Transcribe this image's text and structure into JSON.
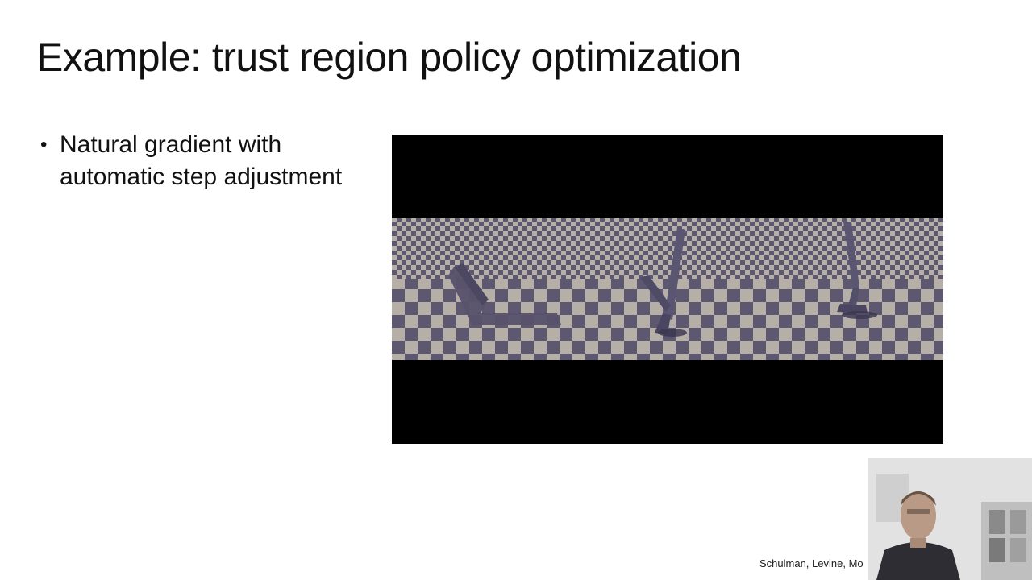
{
  "slide": {
    "title": "Example: trust region policy optimization",
    "bullets": [
      {
        "text": "Natural gradient with automatic step adjustment"
      }
    ],
    "bullet_glyph": "•",
    "citation": "Schulman, Levine, Mo"
  },
  "video": {
    "content": "three-hopper-robot-simulation-frames",
    "background_color": "#000000",
    "floor_colors": [
      "#b5afa8",
      "#5d5870"
    ],
    "robot_color": "#5a5570"
  },
  "webcam": {
    "content": "presenter-video-overlay"
  }
}
